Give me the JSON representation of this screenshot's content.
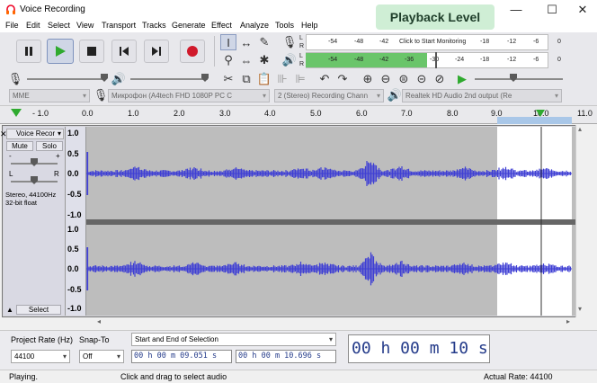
{
  "window": {
    "title": "Voice Recording",
    "minimize": "—",
    "maximize": "☐",
    "close": "✕"
  },
  "menu": [
    "File",
    "Edit",
    "Select",
    "View",
    "Transport",
    "Tracks",
    "Generate",
    "Effect",
    "Analyze",
    "Tools",
    "Help"
  ],
  "tooltip": "Playback Level",
  "meters": {
    "record_ticks": [
      "-54",
      "-48",
      "-42",
      "Click to Start Monitoring",
      "-18",
      "-12",
      "-6",
      "0"
    ],
    "playback_ticks": [
      "-54",
      "-48",
      "-42",
      "-36",
      "-30",
      "-24",
      "-18",
      "-12",
      "-6",
      "0"
    ],
    "lr_l": "L",
    "lr_r": "R"
  },
  "devices": {
    "host": "MME",
    "mic": "Микрофон (A4tech FHD 1080P PC C",
    "channels": "2 (Stereo) Recording Chann",
    "output": "Realtek HD Audio 2nd output (Re"
  },
  "ruler": [
    "- 1.0",
    "0.0",
    "1.0",
    "2.0",
    "3.0",
    "4.0",
    "5.0",
    "6.0",
    "7.0",
    "8.0",
    "9.0",
    "10.0",
    "11.0"
  ],
  "track": {
    "name": "Voice Recor",
    "mute": "Mute",
    "solo": "Solo",
    "gain_minus": "-",
    "gain_plus": "+",
    "pan_l": "L",
    "pan_r": "R",
    "info1": "Stereo, 44100Hz",
    "info2": "32-bit float",
    "select": "Select",
    "scale": [
      "1.0",
      "0.5",
      "0.0",
      "-0.5",
      "-1.0",
      "1.0",
      "0.5",
      "0.0",
      "-0.5",
      "-1.0"
    ]
  },
  "bottom": {
    "rate_label": "Project Rate (Hz)",
    "rate_value": "44100",
    "snap_label": "Snap-To",
    "snap_value": "Off",
    "sel_mode": "Start and End of Selection",
    "start_time": "00 h 00 m 09.051 s",
    "end_time": "00 h 00 m 10.696 s",
    "big_time": "00 h 00 m 10 s"
  },
  "status": {
    "state": "Playing.",
    "hint": "Click and drag to select audio",
    "rate": "Actual Rate: 44100"
  },
  "colors": {
    "waveform": "#3f3fd4",
    "play_level": "#6ac56a",
    "time_text": "#243b8a"
  }
}
